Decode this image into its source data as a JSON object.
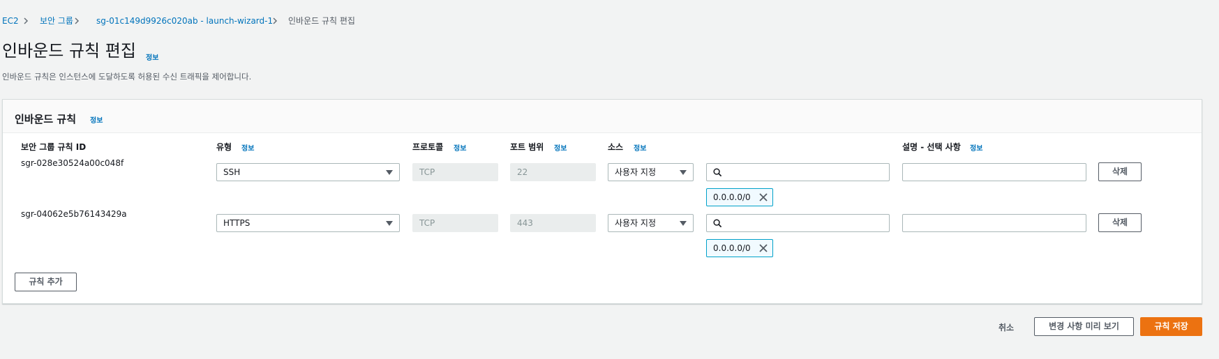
{
  "breadcrumb": {
    "items": [
      "EC2",
      "보안 그룹",
      "sg-01c149d9926c020ab - launch-wizard-1",
      "인바운드 규칙 편집"
    ]
  },
  "page": {
    "title": "인바운드 규칙 편집",
    "info": "정보",
    "description": "인바운드 규칙은 인스턴스에 도달하도록 허용된 수신 트래픽을 제어합니다."
  },
  "panel": {
    "title": "인바운드 규칙",
    "info": "정보",
    "columns": {
      "rule_id": "보안 그룹 규칙 ID",
      "type": "유형",
      "protocol": "프로토콜",
      "port_range": "포트 범위",
      "source": "소스",
      "description": "설명 - 선택 사항",
      "info": "정보"
    },
    "rows": [
      {
        "rule_id": "sgr-028e30524a00c048f",
        "type": "SSH",
        "protocol": "TCP",
        "port_range": "22",
        "source_type": "사용자 지정",
        "source_search": "",
        "source_token": "0.0.0.0/0",
        "description": "",
        "delete": "삭제"
      },
      {
        "rule_id": "sgr-04062e5b76143429a",
        "type": "HTTPS",
        "protocol": "TCP",
        "port_range": "443",
        "source_type": "사용자 지정",
        "source_search": "",
        "source_token": "0.0.0.0/0",
        "description": "",
        "delete": "삭제"
      }
    ],
    "add_rule": "규칙 추가"
  },
  "footer": {
    "cancel": "취소",
    "preview": "변경 사항 미리 보기",
    "save": "규칙 저장"
  },
  "colors": {
    "link": "#0073bb",
    "primary": "#ec7211",
    "token_border": "#00a1c9"
  }
}
